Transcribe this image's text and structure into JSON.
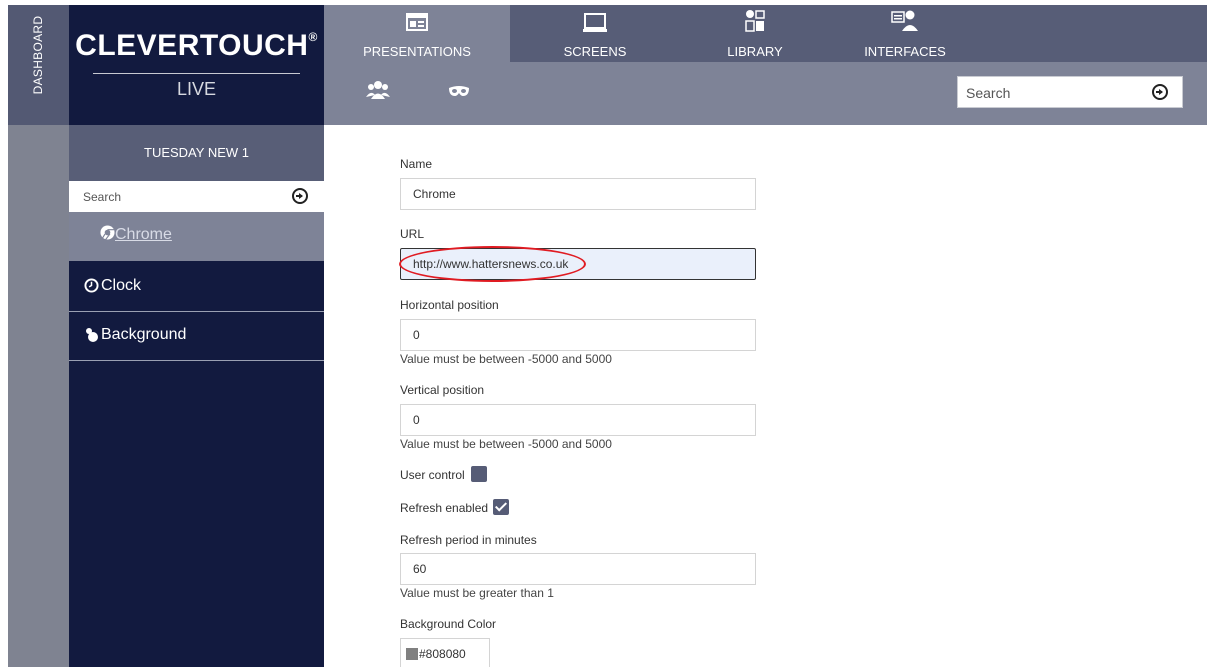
{
  "dashboard": {
    "label": "DASHBOARD"
  },
  "logo": {
    "title": "CLEVERTOUCH",
    "reg_mark": "®",
    "subtitle": "LIVE"
  },
  "nav": {
    "tabs": [
      {
        "label": "PRESENTATIONS",
        "icon": "presentations-icon",
        "active": true
      },
      {
        "label": "SCREENS",
        "icon": "screens-icon",
        "active": false
      },
      {
        "label": "LIBRARY",
        "icon": "library-icon",
        "active": false
      },
      {
        "label": "INTERFACES",
        "icon": "interfaces-icon",
        "active": false
      }
    ]
  },
  "subbar": {
    "icons": [
      "users-icon",
      "mask-icon"
    ],
    "search_placeholder": "Search"
  },
  "sidebar": {
    "presentation_title": "TUESDAY NEW 1",
    "search_placeholder": "Search",
    "items": [
      {
        "label": "Chrome",
        "icon": "chrome-icon",
        "selected": true
      },
      {
        "label": "Clock",
        "icon": "clock-icon",
        "selected": false
      },
      {
        "label": "Background",
        "icon": "background-icon",
        "selected": false
      }
    ]
  },
  "form": {
    "name_label": "Name",
    "name_value": "Chrome",
    "url_label": "URL",
    "url_value": "http://www.hattersnews.co.uk",
    "hpos_label": "Horizontal position",
    "hpos_value": "0",
    "hpos_hint": "Value must be between -5000 and 5000",
    "vpos_label": "Vertical position",
    "vpos_value": "0",
    "vpos_hint": "Value must be between -5000 and 5000",
    "user_control_label": "User control",
    "user_control_checked": false,
    "refresh_enabled_label": "Refresh enabled",
    "refresh_enabled_checked": true,
    "refresh_period_label": "Refresh period in minutes",
    "refresh_period_value": "60",
    "refresh_period_hint": "Value must be greater than 1",
    "bgcolor_label": "Background Color",
    "bgcolor_value": "#808080"
  },
  "colors": {
    "sidebar_bg": "#121a3f",
    "nav_bg": "#575d77",
    "nav_active": "#7e8397",
    "annotation": "#e01b22"
  }
}
